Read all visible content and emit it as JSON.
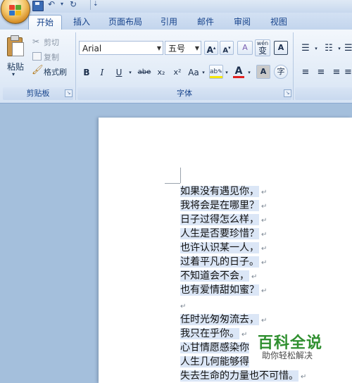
{
  "tabs": [
    "开始",
    "插入",
    "页面布局",
    "引用",
    "邮件",
    "审阅",
    "视图"
  ],
  "clipboard": {
    "paste": "粘贴",
    "cut": "剪切",
    "copy": "复制",
    "format_painter": "格式刷",
    "group_label": "剪贴板"
  },
  "font": {
    "name": "Arial",
    "size": "五号",
    "group_label": "字体",
    "buttons": {
      "bold": "B",
      "italic": "I",
      "underline": "U",
      "strikethrough": "abe",
      "subscript": "x₂",
      "superscript": "x²",
      "change_case": "Aa",
      "grow": "A",
      "shrink": "A",
      "clear": "A",
      "phonetic": "wén",
      "phonetic_char": "变",
      "border": "A",
      "shade": "A",
      "enclose": "字"
    }
  },
  "document": {
    "lines": [
      "如果没有遇见你，",
      "我将会是在哪里？",
      "日子过得怎么样，",
      "人生是否要珍惜？",
      "也许认识某一人，",
      "过着平凡的日子。",
      "不知道会不会，",
      "也有爱情甜如蜜？",
      "",
      "任时光匆匆流去，",
      "我只在乎你。",
      "心甘情愿感染你",
      "人生几何能够得",
      "失去生命的力量也不可惜。"
    ],
    "paragraph_mark": "↵"
  },
  "watermark": {
    "title": "百科全说",
    "subtitle": "助你轻松解决"
  },
  "colors": {
    "accent": "#15428b",
    "highlight": "#dbe6f6",
    "font_color": "#e02020",
    "highlight_color": "#f5e60a"
  }
}
